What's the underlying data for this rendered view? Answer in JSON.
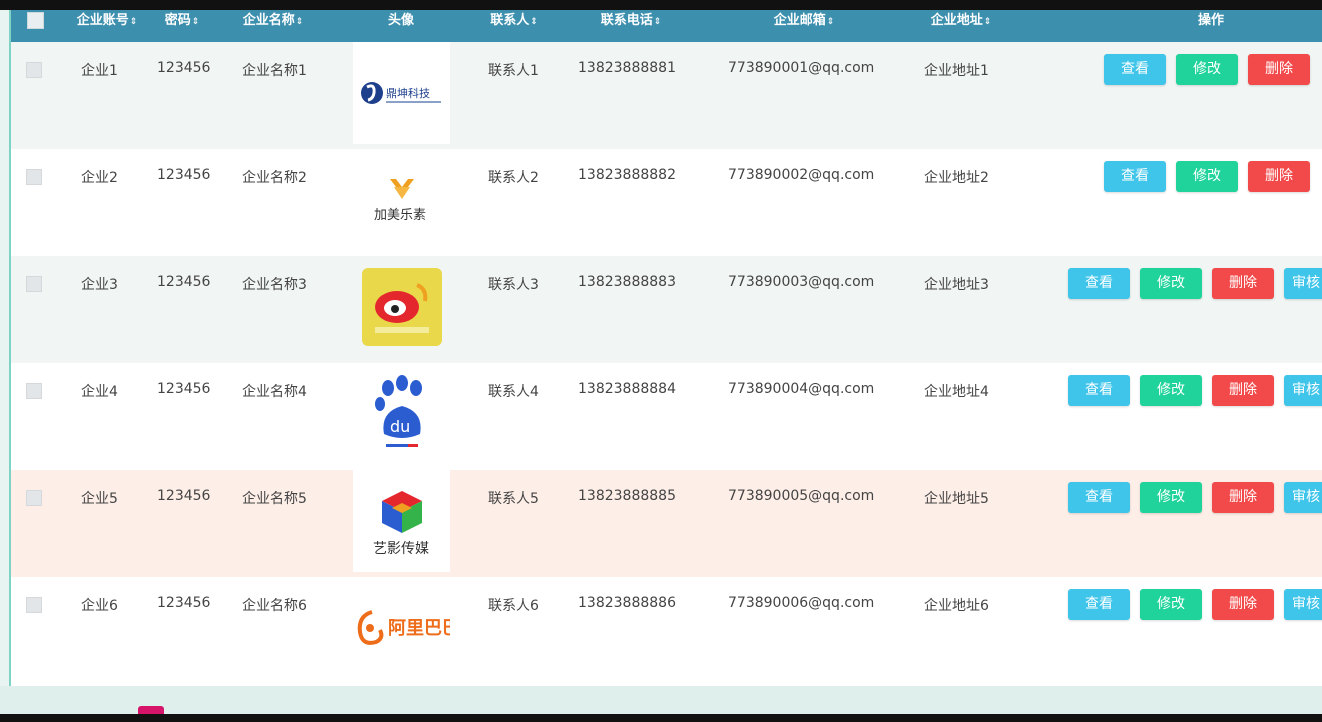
{
  "header": {
    "checkbox": "",
    "columns": [
      "企业账号",
      "密码",
      "企业名称",
      "头像",
      "联系人",
      "联系电话",
      "企业邮箱",
      "企业地址",
      "操作"
    ],
    "sort_glyph": "⇕"
  },
  "buttons": {
    "view": "查看",
    "edit": "修改",
    "delete": "删除",
    "audit": "审核"
  },
  "rows": [
    {
      "account": "企业1",
      "password": "123456",
      "name": "企业名称1",
      "contact": "联系人1",
      "phone": "13823888881",
      "email": "773890001@qq.com",
      "address": "企业地址1",
      "logo": "logo-1",
      "logo_text": "鼎坤科技",
      "has_audit": false
    },
    {
      "account": "企业2",
      "password": "123456",
      "name": "企业名称2",
      "contact": "联系人2",
      "phone": "13823888882",
      "email": "773890002@qq.com",
      "address": "企业地址2",
      "logo": "logo-2",
      "logo_text": "加美乐素",
      "has_audit": false
    },
    {
      "account": "企业3",
      "password": "123456",
      "name": "企业名称3",
      "contact": "联系人3",
      "phone": "13823888883",
      "email": "773890003@qq.com",
      "address": "企业地址3",
      "logo": "weibo-logo",
      "logo_text": "",
      "has_audit": true
    },
    {
      "account": "企业4",
      "password": "123456",
      "name": "企业名称4",
      "contact": "联系人4",
      "phone": "13823888884",
      "email": "773890004@qq.com",
      "address": "企业地址4",
      "logo": "baidu-logo",
      "logo_text": "du",
      "has_audit": true
    },
    {
      "account": "企业5",
      "password": "123456",
      "name": "企业名称5",
      "contact": "联系人5",
      "phone": "13823888885",
      "email": "773890005@qq.com",
      "address": "企业地址5",
      "logo": "cube-logo",
      "logo_text": "艺影传媒",
      "has_audit": true
    },
    {
      "account": "企业6",
      "password": "123456",
      "name": "企业名称6",
      "contact": "联系人6",
      "phone": "13823888886",
      "email": "773890006@qq.com",
      "address": "企业地址6",
      "logo": "alibaba-logo",
      "logo_text": "阿里巴巴",
      "has_audit": true
    }
  ],
  "colors": {
    "header": "#3d8fae",
    "view": "#3fc4ea",
    "edit": "#1fd39a",
    "delete": "#f24a4a",
    "odd_row": "#f1f5f3",
    "highlight_row": "#fdeee8"
  }
}
